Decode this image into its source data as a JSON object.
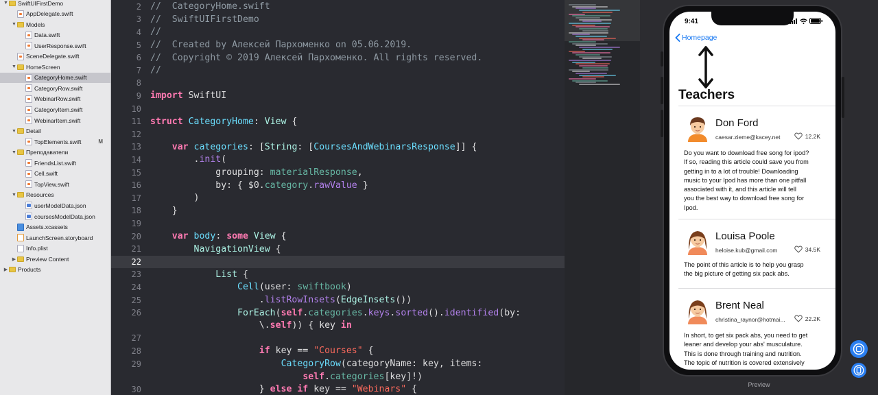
{
  "navigator": {
    "items": [
      {
        "label": "SwiftUIFirstDemo",
        "kind": "folder",
        "depth": 0,
        "disclosure": "open"
      },
      {
        "label": "AppDelegate.swift",
        "kind": "swift",
        "depth": 1,
        "disclosure": ""
      },
      {
        "label": "Models",
        "kind": "folder",
        "depth": 1,
        "disclosure": "open"
      },
      {
        "label": "Data.swift",
        "kind": "swift",
        "depth": 2,
        "disclosure": ""
      },
      {
        "label": "UserResponse.swift",
        "kind": "swift",
        "depth": 2,
        "disclosure": ""
      },
      {
        "label": "SceneDelegate.swift",
        "kind": "swift",
        "depth": 1,
        "disclosure": ""
      },
      {
        "label": "HomeScreen",
        "kind": "folder",
        "depth": 1,
        "disclosure": "open"
      },
      {
        "label": "CategoryHome.swift",
        "kind": "swift",
        "depth": 2,
        "disclosure": "",
        "selected": true
      },
      {
        "label": "CategoryRow.swift",
        "kind": "swift",
        "depth": 2,
        "disclosure": ""
      },
      {
        "label": "WebinarRow.swift",
        "kind": "swift",
        "depth": 2,
        "disclosure": ""
      },
      {
        "label": "CategoryItem.swift",
        "kind": "swift",
        "depth": 2,
        "disclosure": ""
      },
      {
        "label": "WebinarItem.swift",
        "kind": "swift",
        "depth": 2,
        "disclosure": ""
      },
      {
        "label": "Detail",
        "kind": "folder",
        "depth": 1,
        "disclosure": "open"
      },
      {
        "label": "TopElements.swift",
        "kind": "swift",
        "depth": 2,
        "disclosure": "",
        "badge": "M"
      },
      {
        "label": "Преподаватели",
        "kind": "folder",
        "depth": 1,
        "disclosure": "open"
      },
      {
        "label": "FriendsList.swift",
        "kind": "swift",
        "depth": 2,
        "disclosure": ""
      },
      {
        "label": "Cell.swift",
        "kind": "swift",
        "depth": 2,
        "disclosure": ""
      },
      {
        "label": "TopView.swift",
        "kind": "swift",
        "depth": 2,
        "disclosure": ""
      },
      {
        "label": "Resources",
        "kind": "folder",
        "depth": 1,
        "disclosure": "open"
      },
      {
        "label": "userModelData.json",
        "kind": "json",
        "depth": 2,
        "disclosure": ""
      },
      {
        "label": "coursesModelData.json",
        "kind": "json",
        "depth": 2,
        "disclosure": ""
      },
      {
        "label": "Assets.xcassets",
        "kind": "assets",
        "depth": 1,
        "disclosure": ""
      },
      {
        "label": "LaunchScreen.storyboard",
        "kind": "sb",
        "depth": 1,
        "disclosure": ""
      },
      {
        "label": "Info.plist",
        "kind": "plist",
        "depth": 1,
        "disclosure": ""
      },
      {
        "label": "Preview Content",
        "kind": "folder",
        "depth": 1,
        "disclosure": "closed"
      },
      {
        "label": "Products",
        "kind": "folder",
        "depth": 0,
        "disclosure": "closed"
      }
    ]
  },
  "editor": {
    "current_line": "22",
    "lines": [
      {
        "n": "2",
        "code": [
          [
            "cm",
            "//  CategoryHome.swift"
          ]
        ]
      },
      {
        "n": "3",
        "code": [
          [
            "cm",
            "//  SwiftUIFirstDemo"
          ]
        ]
      },
      {
        "n": "4",
        "code": [
          [
            "cm",
            "//"
          ]
        ]
      },
      {
        "n": "5",
        "code": [
          [
            "cm",
            "//  Created by Алексей Пархоменко on 05.06.2019."
          ]
        ]
      },
      {
        "n": "6",
        "code": [
          [
            "cm",
            "//  Copyright © 2019 Алексей Пархоменко. All rights reserved."
          ]
        ]
      },
      {
        "n": "7",
        "code": [
          [
            "cm",
            "//"
          ]
        ]
      },
      {
        "n": "8",
        "code": []
      },
      {
        "n": "9",
        "code": [
          [
            "kw",
            "import"
          ],
          [
            "pl",
            " SwiftUI"
          ]
        ]
      },
      {
        "n": "10",
        "code": []
      },
      {
        "n": "11",
        "code": [
          [
            "kw",
            "struct"
          ],
          [
            "pl",
            " "
          ],
          [
            "ty",
            "CategoryHome"
          ],
          [
            "pl",
            ": "
          ],
          [
            "ty2",
            "View"
          ],
          [
            "pl",
            " {"
          ]
        ]
      },
      {
        "n": "12",
        "code": []
      },
      {
        "n": "13",
        "code": [
          [
            "pl",
            "    "
          ],
          [
            "kw",
            "var"
          ],
          [
            "pl",
            " "
          ],
          [
            "ty",
            "categories"
          ],
          [
            "pl",
            ": ["
          ],
          [
            "ty2",
            "String"
          ],
          [
            "pl",
            ": ["
          ],
          [
            "ty",
            "CoursesAndWebinarsResponse"
          ],
          [
            "pl",
            "]] {"
          ]
        ]
      },
      {
        "n": "14",
        "code": [
          [
            "pl",
            "        ."
          ],
          [
            "fn2",
            "init"
          ],
          [
            "pl",
            "("
          ]
        ]
      },
      {
        "n": "15",
        "code": [
          [
            "pl",
            "            grouping: "
          ],
          [
            "fn",
            "materialResponse"
          ],
          [
            "pl",
            ","
          ]
        ]
      },
      {
        "n": "16",
        "code": [
          [
            "pl",
            "            by: { $0."
          ],
          [
            "fn",
            "category"
          ],
          [
            "pl",
            "."
          ],
          [
            "fn2",
            "rawValue"
          ],
          [
            "pl",
            " }"
          ]
        ]
      },
      {
        "n": "17",
        "code": [
          [
            "pl",
            "        )"
          ]
        ]
      },
      {
        "n": "18",
        "code": [
          [
            "pl",
            "    }"
          ]
        ]
      },
      {
        "n": "19",
        "code": []
      },
      {
        "n": "20",
        "code": [
          [
            "pl",
            "    "
          ],
          [
            "kw",
            "var"
          ],
          [
            "pl",
            " "
          ],
          [
            "ty",
            "body"
          ],
          [
            "pl",
            ": "
          ],
          [
            "kw",
            "some"
          ],
          [
            "pl",
            " "
          ],
          [
            "ty2",
            "View"
          ],
          [
            "pl",
            " {"
          ]
        ]
      },
      {
        "n": "21",
        "code": [
          [
            "pl",
            "        "
          ],
          [
            "ty2",
            "NavigationView"
          ],
          [
            "pl",
            " {"
          ]
        ]
      },
      {
        "n": "22",
        "code": []
      },
      {
        "n": "23",
        "code": [
          [
            "pl",
            "            "
          ],
          [
            "ty2",
            "List"
          ],
          [
            "pl",
            " {"
          ]
        ]
      },
      {
        "n": "24",
        "code": [
          [
            "pl",
            "                "
          ],
          [
            "ty",
            "Cell"
          ],
          [
            "pl",
            "(user: "
          ],
          [
            "fn",
            "swiftbook"
          ],
          [
            "pl",
            ")"
          ]
        ]
      },
      {
        "n": "25",
        "code": [
          [
            "pl",
            "                    ."
          ],
          [
            "fn2",
            "listRowInsets"
          ],
          [
            "pl",
            "("
          ],
          [
            "ty2",
            "EdgeInsets"
          ],
          [
            "pl",
            "())"
          ]
        ]
      },
      {
        "n": "26",
        "code": [
          [
            "pl",
            "                "
          ],
          [
            "ty2",
            "ForEach"
          ],
          [
            "pl",
            "("
          ],
          [
            "kw",
            "self"
          ],
          [
            "pl",
            "."
          ],
          [
            "fn",
            "categories"
          ],
          [
            "pl",
            "."
          ],
          [
            "fn2",
            "keys"
          ],
          [
            "pl",
            "."
          ],
          [
            "fn2",
            "sorted"
          ],
          [
            "pl",
            "()."
          ],
          [
            "fn2",
            "identified"
          ],
          [
            "pl",
            "(by:"
          ]
        ]
      },
      {
        "n": "",
        "code": [
          [
            "pl",
            "                    \\."
          ],
          [
            "kw",
            "self"
          ],
          [
            "pl",
            ")) { key "
          ],
          [
            "kw",
            "in"
          ]
        ]
      },
      {
        "n": "27",
        "code": []
      },
      {
        "n": "28",
        "code": [
          [
            "pl",
            "                    "
          ],
          [
            "kw",
            "if"
          ],
          [
            "pl",
            " key == "
          ],
          [
            "str",
            "\"Courses\""
          ],
          [
            "pl",
            " {"
          ]
        ]
      },
      {
        "n": "29",
        "code": [
          [
            "pl",
            "                        "
          ],
          [
            "ty",
            "CategoryRow"
          ],
          [
            "pl",
            "(categoryName: key, items:"
          ]
        ]
      },
      {
        "n": "",
        "code": [
          [
            "pl",
            "                            "
          ],
          [
            "kw",
            "self"
          ],
          [
            "pl",
            "."
          ],
          [
            "fn",
            "categories"
          ],
          [
            "pl",
            "[key]!)"
          ]
        ]
      },
      {
        "n": "30",
        "code": [
          [
            "pl",
            "                    } "
          ],
          [
            "kw",
            "else if"
          ],
          [
            "pl",
            " key == "
          ],
          [
            "str",
            "\"Webinars\""
          ],
          [
            "pl",
            " {"
          ]
        ]
      }
    ]
  },
  "preview": {
    "label": "Preview",
    "phone": {
      "time": "9:41",
      "back_label": "Homepage",
      "title": "Teachers",
      "teachers": [
        {
          "name": "Don Ford",
          "email": "caesar.zieme@kacey.net",
          "likes": "12.2K",
          "gender": "male",
          "bio": [
            "Do you want to download free song for ipod?",
            "If so, reading this article could save you from",
            "getting in to a lot of trouble! Downloading",
            "music to your Ipod has more than one pitfall",
            "associated with it, and this article will tell",
            "you the best way to download free song for",
            "Ipod."
          ]
        },
        {
          "name": "Louisa Poole",
          "email": "heloise.kub@gmail.com",
          "likes": "34.5K",
          "gender": "female",
          "bio": [
            "The point of this article is to help you grasp",
            "the big picture of getting six pack abs."
          ]
        },
        {
          "name": "Brent Neal",
          "email": "christina_raynor@hotmai...",
          "likes": "22.2K",
          "gender": "female",
          "bio": [
            "In short, to get six pack abs, you need to get",
            "leaner and develop your abs' musculature.",
            "This is done through training and nutrition.",
            "The topic of nutrition is covered extensively"
          ]
        }
      ]
    }
  },
  "colors": {
    "accent": "#1778f2",
    "selection": "#c6c6cc",
    "editor_bg": "#292a30",
    "current_line": "#3a3b41"
  }
}
